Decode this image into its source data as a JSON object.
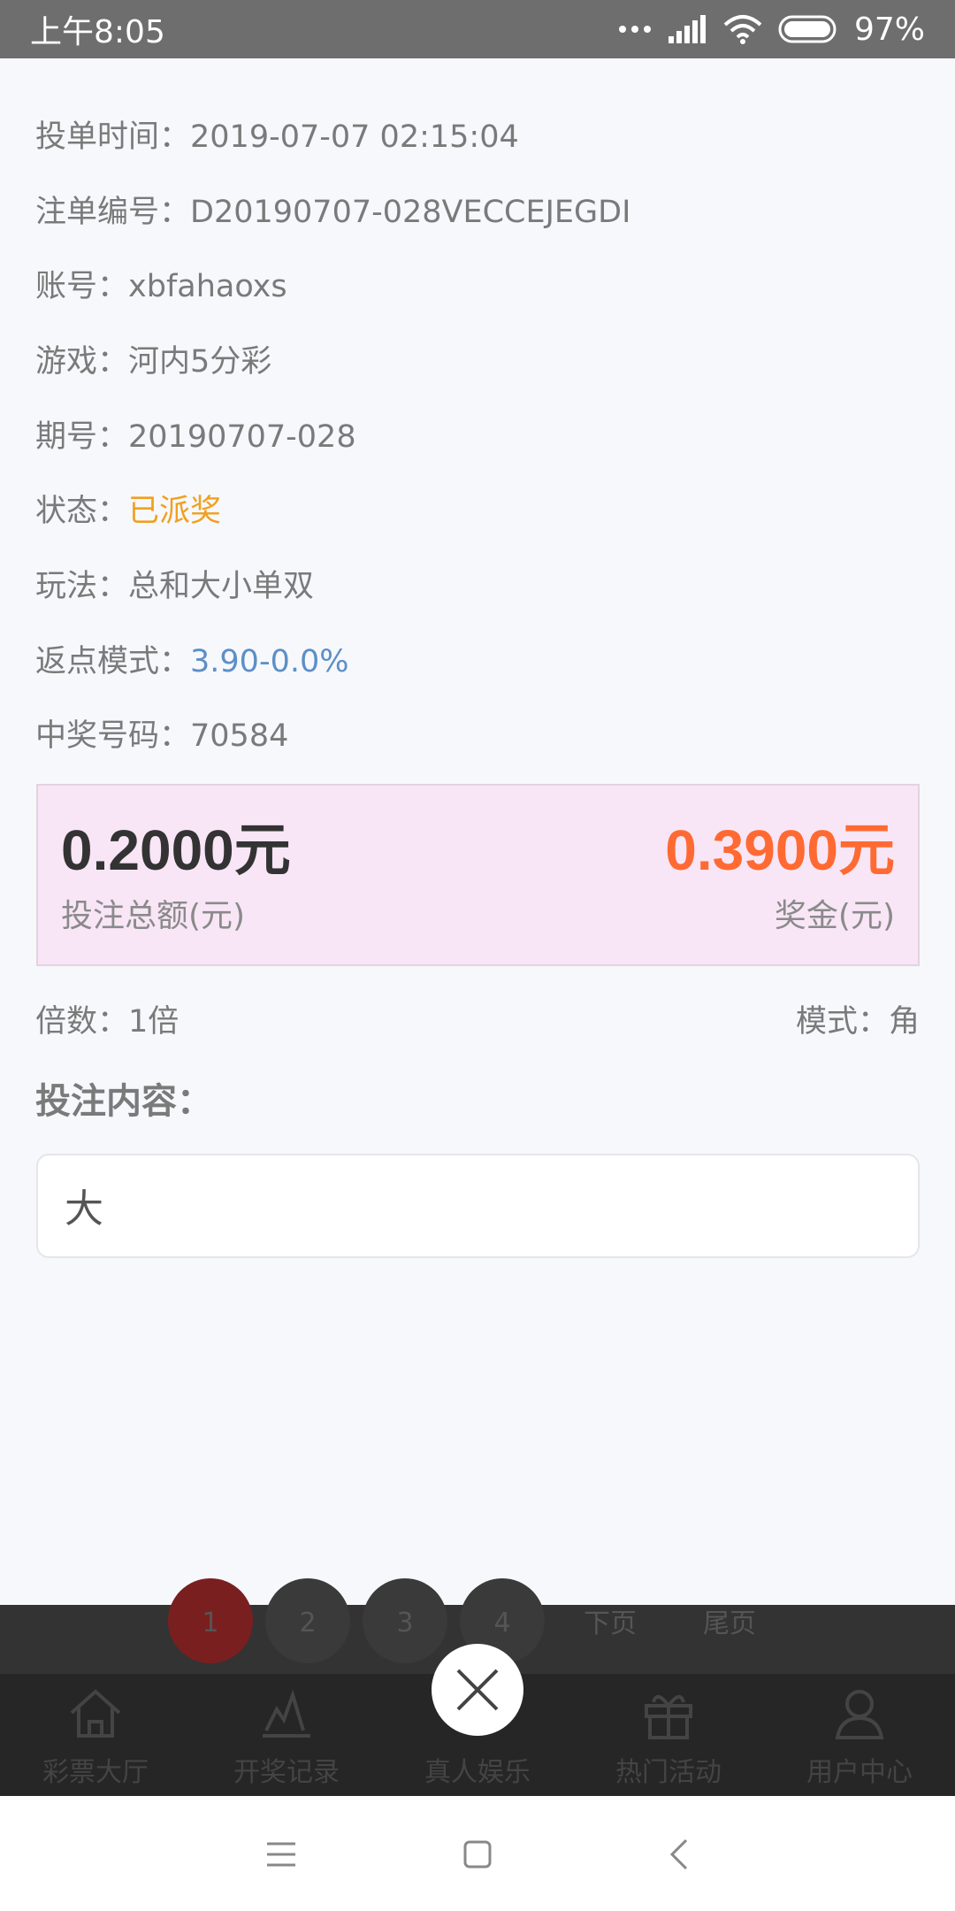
{
  "status_bar": {
    "time": "上午8:05",
    "battery": "97%"
  },
  "details": [
    {
      "label": "投单时间：",
      "value": "2019-07-07 02:15:04",
      "color": "normal"
    },
    {
      "label": "注单编号：",
      "value": "D20190707-028VECCEJEGDI",
      "color": "normal"
    },
    {
      "label": "账号：",
      "value": "xbfahaoxs",
      "color": "normal"
    },
    {
      "label": "游戏：",
      "value": "河内5分彩",
      "color": "normal"
    },
    {
      "label": "期号：",
      "value": "20190707-028",
      "color": "normal"
    },
    {
      "label": "状态：",
      "value": "已派奖",
      "color": "orange"
    },
    {
      "label": "玩法：",
      "value": "总和大小单双",
      "color": "normal"
    },
    {
      "label": "返点模式：",
      "value": "3.90-0.0%",
      "color": "blue"
    },
    {
      "label": "中奖号码：",
      "value": "70584",
      "color": "normal"
    }
  ],
  "amounts": {
    "bet_total_value": "0.2000元",
    "bet_total_label": "投注总额(元)",
    "prize_value": "0.3900元",
    "prize_label": "奖金(元)"
  },
  "meta": {
    "multiplier": "倍数：1倍",
    "mode": "模式：角"
  },
  "bet_content": {
    "title": "投注内容：",
    "value": "大"
  },
  "pager": {
    "items": [
      "1",
      "2",
      "3",
      "4"
    ],
    "next": "下页",
    "last": "尾页"
  },
  "tabbar": [
    {
      "label": "彩票大厅",
      "icon": "home-icon"
    },
    {
      "label": "开奖记录",
      "icon": "chart-icon"
    },
    {
      "label": "真人娱乐",
      "icon": "live-icon"
    },
    {
      "label": "热门活动",
      "icon": "gift-icon"
    },
    {
      "label": "用户中心",
      "icon": "user-icon"
    }
  ],
  "colors": {
    "accent_orange": "#ff6a33",
    "status_orange": "#f0a020",
    "link_blue": "#5c8fc8",
    "amount_box_bg": "#f8e6f6"
  }
}
